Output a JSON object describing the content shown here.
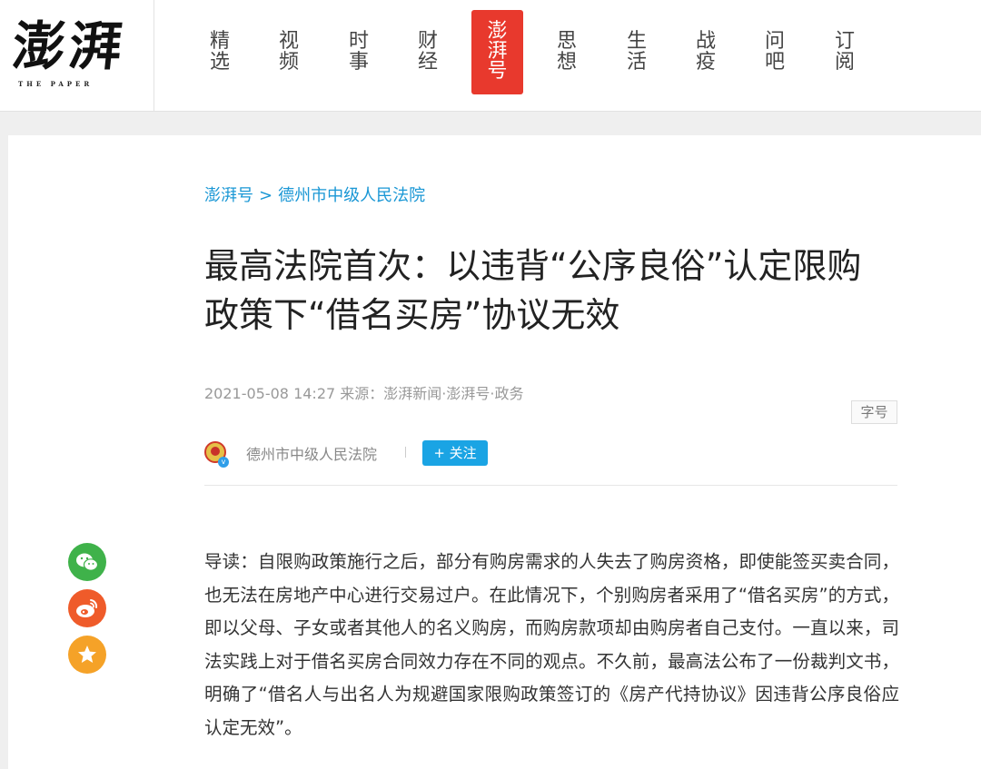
{
  "header": {
    "logo_cn": "澎湃",
    "logo_en": "THE PAPER",
    "nav": [
      {
        "label": [
          "精",
          "选"
        ]
      },
      {
        "label": [
          "视",
          "频"
        ]
      },
      {
        "label": [
          "时",
          "事"
        ]
      },
      {
        "label": [
          "财",
          "经"
        ]
      },
      {
        "label": [
          "澎",
          "湃",
          "号"
        ],
        "active": true
      },
      {
        "label": [
          "思",
          "想"
        ]
      },
      {
        "label": [
          "生",
          "活"
        ]
      },
      {
        "label": [
          "战",
          "疫"
        ]
      },
      {
        "label": [
          "问",
          "吧"
        ]
      },
      {
        "label": [
          "订",
          "阅"
        ]
      }
    ]
  },
  "article": {
    "breadcrumb": {
      "section": "澎湃号",
      "separator": ">",
      "account": "德州市中级人民法院"
    },
    "title": "最高法院首次：以违背“公序良俗”认定限购政策下“借名买房”协议无效",
    "meta": "2021-05-08 14:27 来源：澎湃新闻·澎湃号·政务",
    "font_size_label": "字号",
    "author": {
      "name": "德州市中级人民法院",
      "verified_badge": "v",
      "follow_label": "+ 关注"
    },
    "lead": "导读：自限购政策施行之后，部分有购房需求的人失去了购房资格，即使能签买卖合同，也无法在房地产中心进行交易过户。在此情况下，个别购房者采用了“借名买房”的方式，即以父母、子女或者其他人的名义购房，而购房款项却由购房者自己支付。一直以来，司法实践上对于借名买房合同效力存在不同的观点。不久前，最高法公布了一份裁判文书，明确了“借名人与出名人为规避国家限购政策签订的《房产代持协议》因违背公序良俗应认定无效”。"
  },
  "share": [
    {
      "icon": "wechat-icon",
      "color": "#3fb24a"
    },
    {
      "icon": "weibo-icon",
      "color": "#ef5b2a"
    },
    {
      "icon": "favorite-star-icon",
      "color": "#f5a228"
    }
  ]
}
